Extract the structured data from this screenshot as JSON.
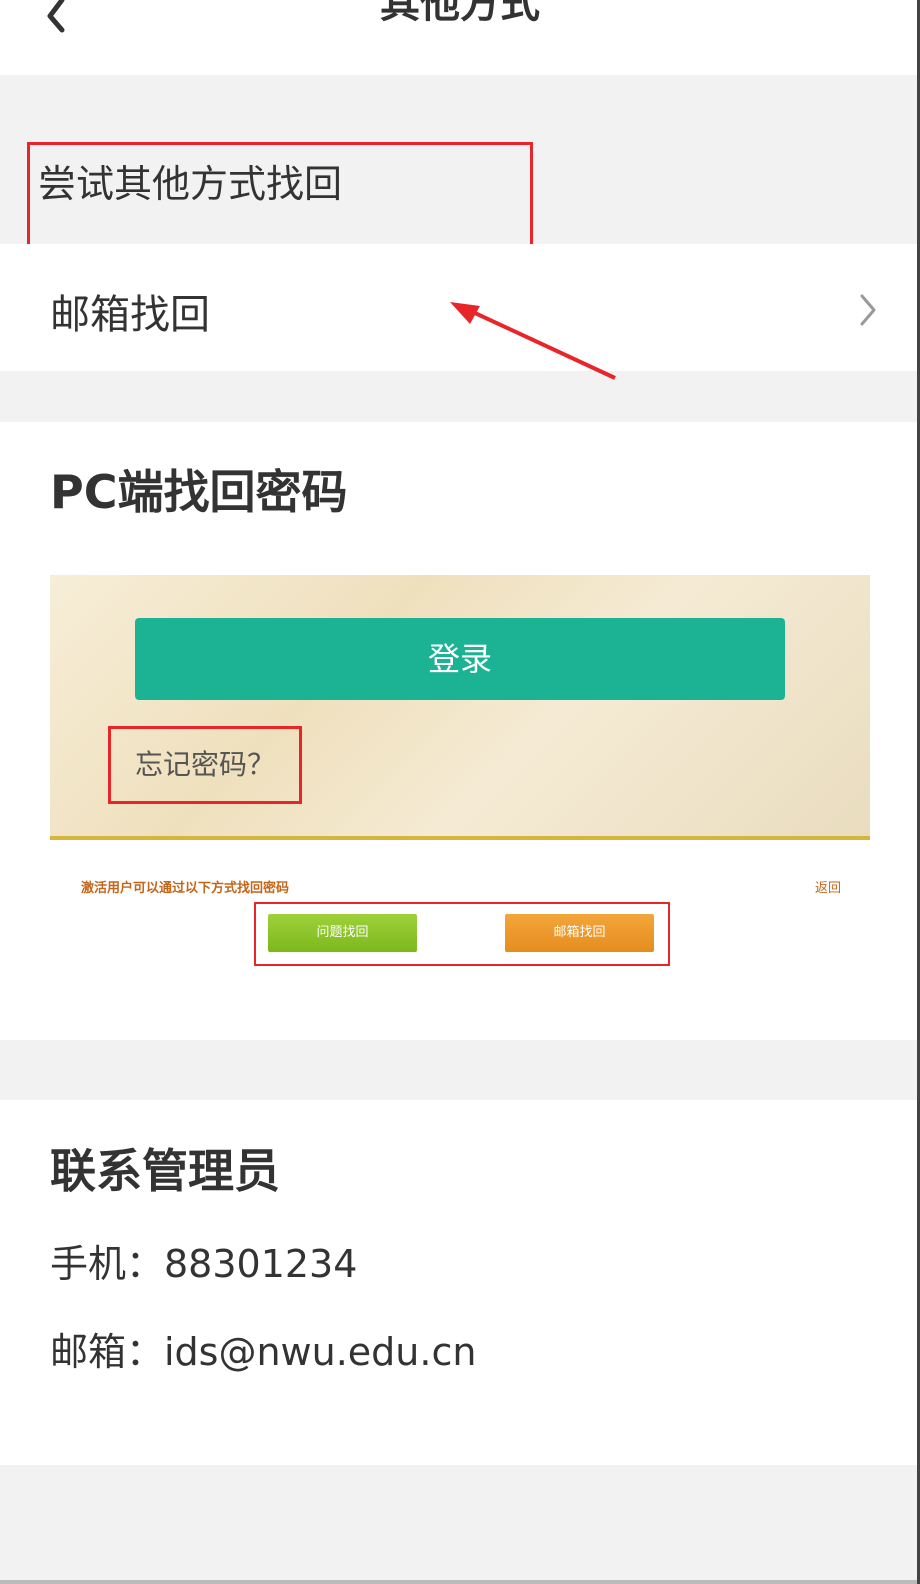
{
  "header": {
    "title": "其他方式",
    "back_icon": "chevron-left-icon"
  },
  "other_methods": {
    "hint": "尝试其他方式找回",
    "email_recovery_label": "邮箱找回",
    "chevron_icon": "chevron-right-icon"
  },
  "pc_section": {
    "title": "PC端找回密码",
    "screenshot": {
      "login_label": "登录",
      "forgot_label": "忘记密码？",
      "reset_hint": "激活用户可以通过以下方式找回密码",
      "back_label": "返回",
      "question_button": "问题找回",
      "mail_button": "邮箱找回"
    }
  },
  "contact": {
    "title": "联系管理员",
    "phone": "手机：88301234",
    "email": "邮箱：ids@nwu.edu.cn"
  },
  "colors": {
    "annotation_red": "#e8262a",
    "login_green": "#1bb394",
    "question_green": "#8cc42a",
    "mail_orange": "#eb9a2c"
  }
}
